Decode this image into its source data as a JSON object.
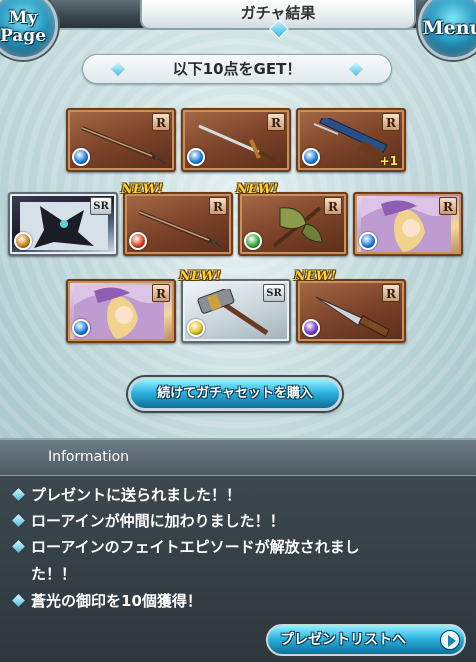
{
  "header": {
    "title": "ガチャ結果",
    "mypage_label_line1": "My",
    "mypage_label_line2": "Page",
    "menu_label": "Menu"
  },
  "banner": {
    "text": "以下10点をGET！"
  },
  "cards": [
    {
      "type": "weapon",
      "rarity": "R",
      "element": "water",
      "new": false,
      "plus": "",
      "icon": "spear-icon"
    },
    {
      "type": "weapon",
      "rarity": "R",
      "element": "water",
      "new": false,
      "plus": "",
      "icon": "sword-icon"
    },
    {
      "type": "weapon",
      "rarity": "R",
      "element": "water",
      "new": false,
      "plus": "+1",
      "icon": "gun-icon"
    },
    {
      "type": "summon",
      "rarity": "SR",
      "element": "earth",
      "new": false,
      "plus": "",
      "icon": "dark-summon-portrait"
    },
    {
      "type": "weapon",
      "rarity": "R",
      "element": "fire",
      "new": true,
      "plus": "",
      "icon": "spear-icon"
    },
    {
      "type": "weapon",
      "rarity": "R",
      "element": "wind",
      "new": true,
      "plus": "",
      "icon": "axe-icon"
    },
    {
      "type": "character",
      "rarity": "R",
      "element": "water",
      "new": false,
      "plus": "",
      "icon": "character-portrait"
    },
    {
      "type": "character",
      "rarity": "R",
      "element": "water",
      "new": false,
      "plus": "",
      "icon": "character-portrait"
    },
    {
      "type": "weapon",
      "rarity": "SR",
      "element": "light",
      "new": true,
      "plus": "",
      "icon": "hammer-icon"
    },
    {
      "type": "weapon",
      "rarity": "R",
      "element": "dark",
      "new": true,
      "plus": "",
      "icon": "knife-icon"
    }
  ],
  "new_label": "NEW!",
  "purchase_button": {
    "label": "続けてガチャセットを購入"
  },
  "info": {
    "heading": "Information",
    "lines": [
      "プレゼントに送られました！！",
      "ローアインが仲間に加わりました！！",
      "ローアインのフェイトエピソードが解放されまし",
      "た！！",
      "蒼光の御印を10個獲得！"
    ],
    "present_list_button": "プレゼントリストへ"
  },
  "colors": {
    "fire": "#d8431e",
    "water": "#1f7fe0",
    "earth": "#c8861a",
    "wind": "#3aa83a",
    "light": "#e2c21c",
    "dark": "#7a3cc8"
  }
}
